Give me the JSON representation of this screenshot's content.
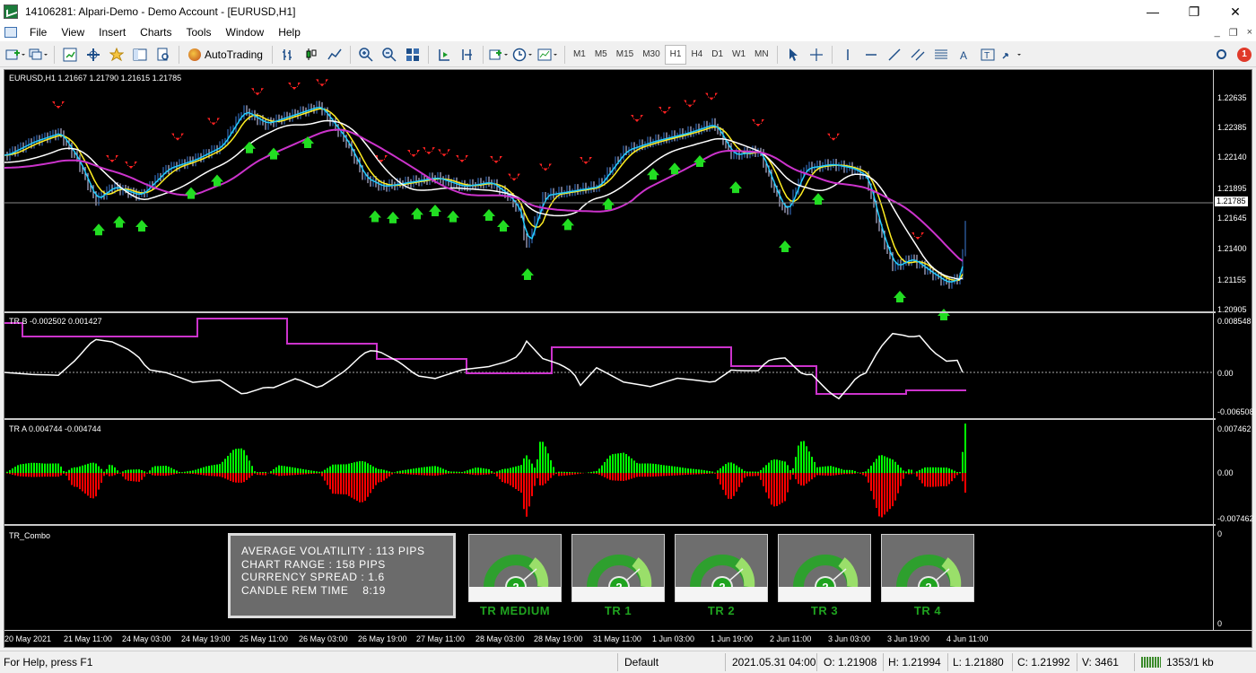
{
  "window": {
    "title": "14106281: Alpari-Demo - Demo Account - [EURUSD,H1]",
    "controls": [
      "—",
      "❐",
      "✕"
    ]
  },
  "menubar": {
    "items": [
      "File",
      "View",
      "Insert",
      "Charts",
      "Tools",
      "Window",
      "Help"
    ],
    "mdi_controls": [
      "_",
      "❐",
      "×"
    ]
  },
  "toolbar": {
    "autotrading_label": "AutoTrading",
    "timeframes": [
      "M1",
      "M5",
      "M15",
      "M30",
      "H1",
      "H4",
      "D1",
      "W1",
      "MN"
    ],
    "active_timeframe": "H1",
    "alert_count": "1"
  },
  "chart": {
    "main_label": "EURUSD,H1  1.21667 1.21790 1.21615 1.21785",
    "price_ticks": [
      "1.22635",
      "1.22385",
      "1.22140",
      "1.21895",
      "1.21645",
      "1.21400",
      "1.21155",
      "1.20905"
    ],
    "current_price": "1.21785",
    "trb_label": "TR B -0.002502 0.001427",
    "trb_ticks": [
      "0.008548",
      "0.00",
      "-0.006508"
    ],
    "tra_label": "TR A 0.004744 -0.004744",
    "tra_ticks": [
      "0.007462",
      "0.00",
      "-0.007462"
    ],
    "combo_label": "TR_Combo",
    "combo_ticks": [
      "0",
      "0"
    ],
    "time_labels": [
      "20 May 2021",
      "21 May 11:00",
      "24 May 03:00",
      "24 May 19:00",
      "25 May 11:00",
      "26 May 03:00",
      "26 May 19:00",
      "27 May 11:00",
      "28 May 03:00",
      "28 May 19:00",
      "31 May 11:00",
      "1 Jun 03:00",
      "1 Jun 19:00",
      "2 Jun 11:00",
      "3 Jun 03:00",
      "3 Jun 19:00",
      "4 Jun 11:00"
    ],
    "colors": {
      "background": "#000000",
      "bull_bar": "#00ff00",
      "bear_bar": "#ff0000",
      "ma_white": "#ffffff",
      "ma_magenta": "#cc33cc",
      "ma_yellow": "#ffee22",
      "ma_cyan": "#22ccff",
      "up_arrow": "#22dd22",
      "down_arrow": "#ff2222"
    }
  },
  "combo": {
    "info_lines": [
      "AVERAGE VOLATILITY : 113 PIPS",
      "CHART RANGE : 158 PIPS",
      "CURRENCY SPREAD : 1.6",
      "CANDLE REM TIME    8:19"
    ],
    "gauges": [
      {
        "title": "TR MEDIUM",
        "value": "2"
      },
      {
        "title": "TR 1",
        "value": "2"
      },
      {
        "title": "TR 2",
        "value": "2"
      },
      {
        "title": "TR 3",
        "value": "2"
      },
      {
        "title": "TR 4",
        "value": "2"
      }
    ]
  },
  "statusbar": {
    "help": "For Help, press F1",
    "profile": "Default",
    "datetime": "2021.05.31 04:00",
    "open": "O: 1.21908",
    "high": "H: 1.21994",
    "low": "L: 1.21880",
    "close": "C: 1.21992",
    "volume": "V: 3461",
    "traffic": "1353/1 kb"
  }
}
